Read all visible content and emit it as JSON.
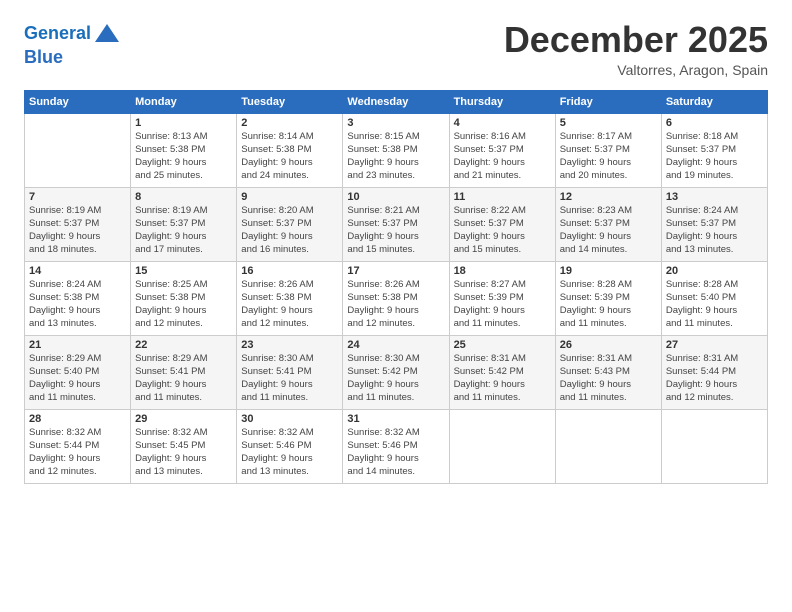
{
  "logo": {
    "line1": "General",
    "line2": "Blue"
  },
  "title": {
    "month": "December 2025",
    "location": "Valtorres, Aragon, Spain"
  },
  "calendar": {
    "headers": [
      "Sunday",
      "Monday",
      "Tuesday",
      "Wednesday",
      "Thursday",
      "Friday",
      "Saturday"
    ],
    "rows": [
      [
        {
          "day": "",
          "info": ""
        },
        {
          "day": "1",
          "info": "Sunrise: 8:13 AM\nSunset: 5:38 PM\nDaylight: 9 hours\nand 25 minutes."
        },
        {
          "day": "2",
          "info": "Sunrise: 8:14 AM\nSunset: 5:38 PM\nDaylight: 9 hours\nand 24 minutes."
        },
        {
          "day": "3",
          "info": "Sunrise: 8:15 AM\nSunset: 5:38 PM\nDaylight: 9 hours\nand 23 minutes."
        },
        {
          "day": "4",
          "info": "Sunrise: 8:16 AM\nSunset: 5:37 PM\nDaylight: 9 hours\nand 21 minutes."
        },
        {
          "day": "5",
          "info": "Sunrise: 8:17 AM\nSunset: 5:37 PM\nDaylight: 9 hours\nand 20 minutes."
        },
        {
          "day": "6",
          "info": "Sunrise: 8:18 AM\nSunset: 5:37 PM\nDaylight: 9 hours\nand 19 minutes."
        }
      ],
      [
        {
          "day": "7",
          "info": "Sunrise: 8:19 AM\nSunset: 5:37 PM\nDaylight: 9 hours\nand 18 minutes."
        },
        {
          "day": "8",
          "info": "Sunrise: 8:19 AM\nSunset: 5:37 PM\nDaylight: 9 hours\nand 17 minutes."
        },
        {
          "day": "9",
          "info": "Sunrise: 8:20 AM\nSunset: 5:37 PM\nDaylight: 9 hours\nand 16 minutes."
        },
        {
          "day": "10",
          "info": "Sunrise: 8:21 AM\nSunset: 5:37 PM\nDaylight: 9 hours\nand 15 minutes."
        },
        {
          "day": "11",
          "info": "Sunrise: 8:22 AM\nSunset: 5:37 PM\nDaylight: 9 hours\nand 15 minutes."
        },
        {
          "day": "12",
          "info": "Sunrise: 8:23 AM\nSunset: 5:37 PM\nDaylight: 9 hours\nand 14 minutes."
        },
        {
          "day": "13",
          "info": "Sunrise: 8:24 AM\nSunset: 5:37 PM\nDaylight: 9 hours\nand 13 minutes."
        }
      ],
      [
        {
          "day": "14",
          "info": "Sunrise: 8:24 AM\nSunset: 5:38 PM\nDaylight: 9 hours\nand 13 minutes."
        },
        {
          "day": "15",
          "info": "Sunrise: 8:25 AM\nSunset: 5:38 PM\nDaylight: 9 hours\nand 12 minutes."
        },
        {
          "day": "16",
          "info": "Sunrise: 8:26 AM\nSunset: 5:38 PM\nDaylight: 9 hours\nand 12 minutes."
        },
        {
          "day": "17",
          "info": "Sunrise: 8:26 AM\nSunset: 5:38 PM\nDaylight: 9 hours\nand 12 minutes."
        },
        {
          "day": "18",
          "info": "Sunrise: 8:27 AM\nSunset: 5:39 PM\nDaylight: 9 hours\nand 11 minutes."
        },
        {
          "day": "19",
          "info": "Sunrise: 8:28 AM\nSunset: 5:39 PM\nDaylight: 9 hours\nand 11 minutes."
        },
        {
          "day": "20",
          "info": "Sunrise: 8:28 AM\nSunset: 5:40 PM\nDaylight: 9 hours\nand 11 minutes."
        }
      ],
      [
        {
          "day": "21",
          "info": "Sunrise: 8:29 AM\nSunset: 5:40 PM\nDaylight: 9 hours\nand 11 minutes."
        },
        {
          "day": "22",
          "info": "Sunrise: 8:29 AM\nSunset: 5:41 PM\nDaylight: 9 hours\nand 11 minutes."
        },
        {
          "day": "23",
          "info": "Sunrise: 8:30 AM\nSunset: 5:41 PM\nDaylight: 9 hours\nand 11 minutes."
        },
        {
          "day": "24",
          "info": "Sunrise: 8:30 AM\nSunset: 5:42 PM\nDaylight: 9 hours\nand 11 minutes."
        },
        {
          "day": "25",
          "info": "Sunrise: 8:31 AM\nSunset: 5:42 PM\nDaylight: 9 hours\nand 11 minutes."
        },
        {
          "day": "26",
          "info": "Sunrise: 8:31 AM\nSunset: 5:43 PM\nDaylight: 9 hours\nand 11 minutes."
        },
        {
          "day": "27",
          "info": "Sunrise: 8:31 AM\nSunset: 5:44 PM\nDaylight: 9 hours\nand 12 minutes."
        }
      ],
      [
        {
          "day": "28",
          "info": "Sunrise: 8:32 AM\nSunset: 5:44 PM\nDaylight: 9 hours\nand 12 minutes."
        },
        {
          "day": "29",
          "info": "Sunrise: 8:32 AM\nSunset: 5:45 PM\nDaylight: 9 hours\nand 13 minutes."
        },
        {
          "day": "30",
          "info": "Sunrise: 8:32 AM\nSunset: 5:46 PM\nDaylight: 9 hours\nand 13 minutes."
        },
        {
          "day": "31",
          "info": "Sunrise: 8:32 AM\nSunset: 5:46 PM\nDaylight: 9 hours\nand 14 minutes."
        },
        {
          "day": "",
          "info": ""
        },
        {
          "day": "",
          "info": ""
        },
        {
          "day": "",
          "info": ""
        }
      ]
    ]
  }
}
